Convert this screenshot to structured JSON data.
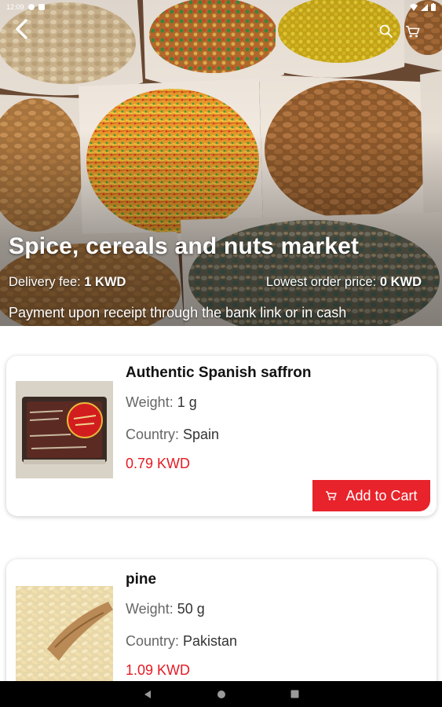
{
  "status_bar": {
    "time": "12:09"
  },
  "header": {
    "icons": {
      "back": "back-arrow-icon",
      "search": "search-icon",
      "cart": "cart-icon"
    }
  },
  "store": {
    "title": "Spice, cereals and nuts market",
    "delivery_fee_label": "Delivery fee: ",
    "delivery_fee_value": "1 KWD",
    "min_order_label": "Lowest order price: ",
    "min_order_value": "0 KWD",
    "payment_note": "Payment upon receipt through the bank link or in cash"
  },
  "products": [
    {
      "name": "Authentic Spanish saffron",
      "weight_label": "Weight: ",
      "weight_value": "1 g",
      "country_label": "Country: ",
      "country_value": "Spain",
      "price": "0.79 KWD",
      "add_label": "Add to Cart"
    },
    {
      "name": "pine",
      "weight_label": "Weight: ",
      "weight_value": "50 g",
      "country_label": "Country: ",
      "country_value": "Pakistan",
      "price": "1.09 KWD"
    }
  ],
  "colors": {
    "accent": "#e8232b",
    "price": "#e31b23"
  },
  "nav": {
    "icons": [
      "nav-back-icon",
      "nav-home-icon",
      "nav-recents-icon"
    ]
  }
}
